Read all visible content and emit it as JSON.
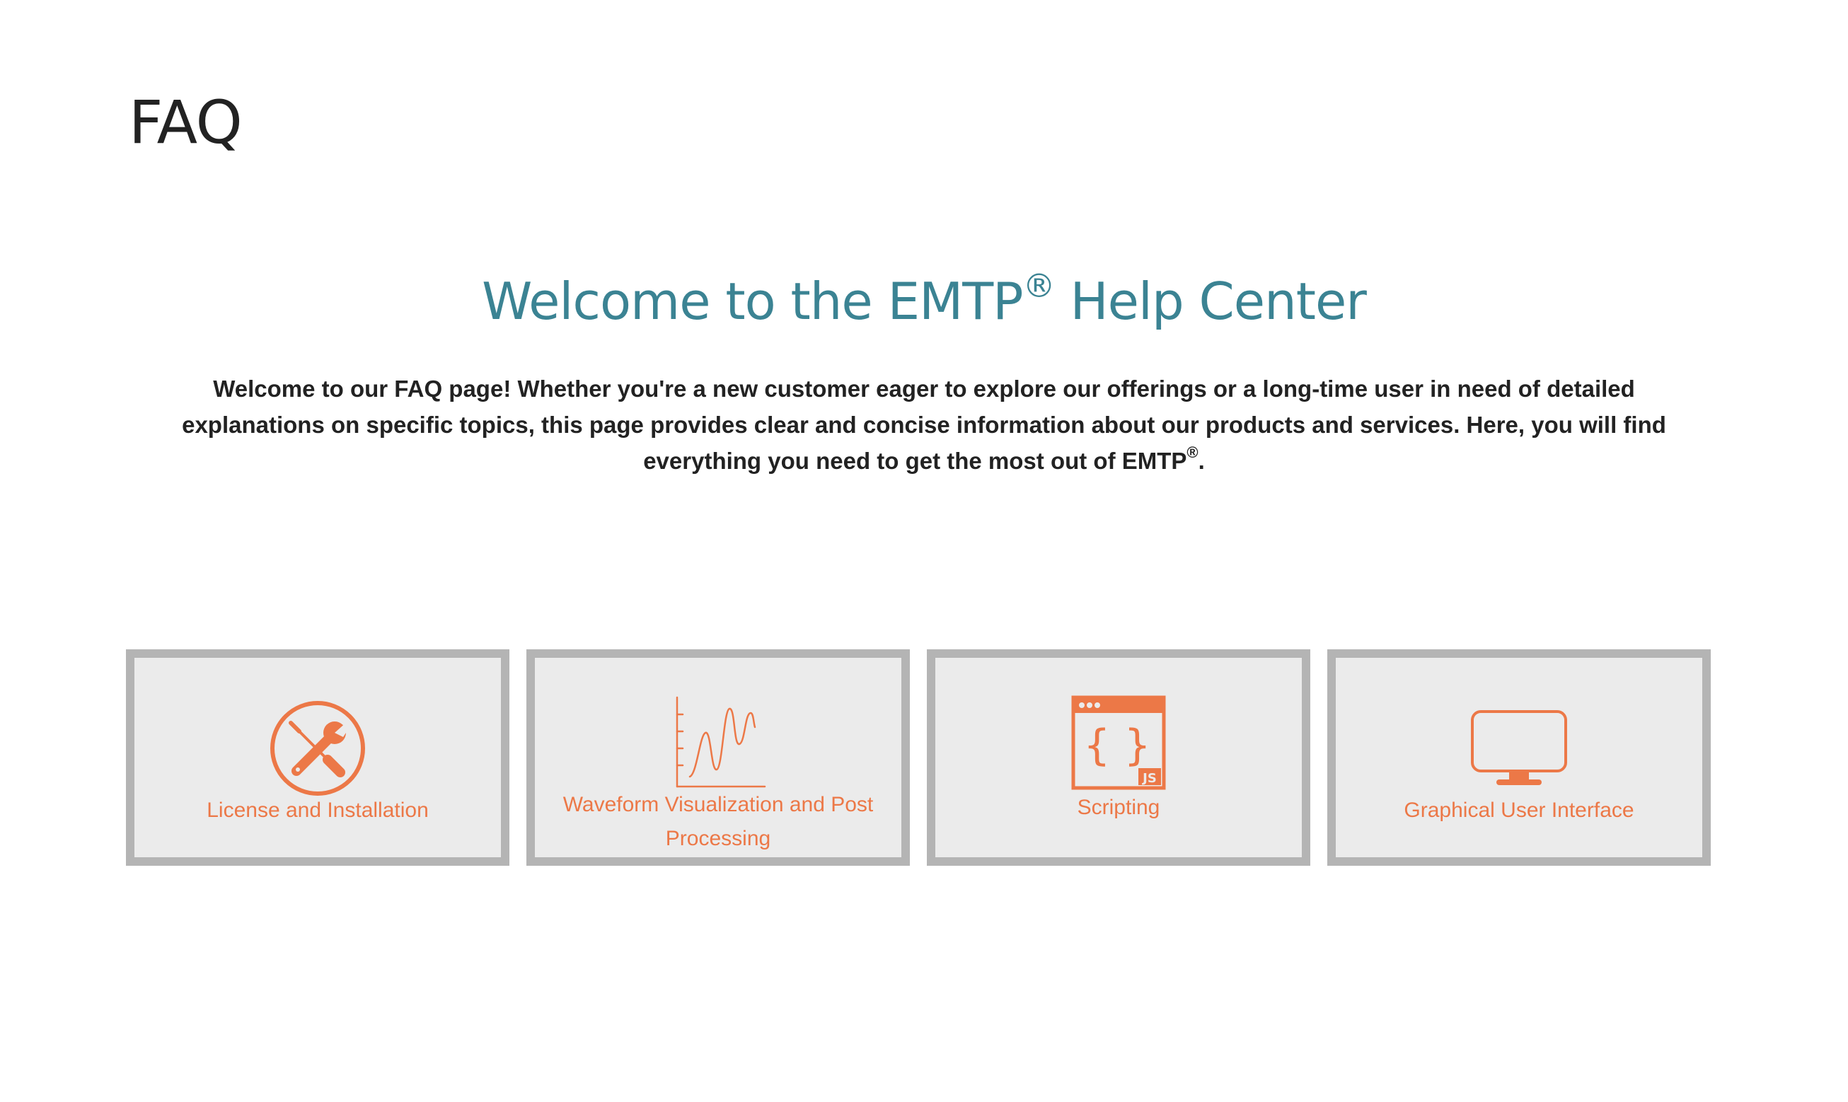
{
  "page": {
    "title": "FAQ"
  },
  "hero": {
    "heading": "Welcome to the EMTP",
    "heading_mark": "®",
    "heading_suffix": " Help Center",
    "intro": "Welcome to our FAQ page! Whether you're a new customer eager to explore our offerings or a long-time user in need of detailed explanations on specific topics, this page provides clear and concise information about our products and services. Here, you will find everything you need to get the most out of EMTP",
    "intro_mark": "®",
    "intro_suffix": "."
  },
  "categories": [
    {
      "label": "License and Installation",
      "icon": "tools-icon"
    },
    {
      "label": "Waveform Visualization and Post Processing",
      "icon": "waveform-chart-icon"
    },
    {
      "label": "Scripting",
      "icon": "javascript-code-icon"
    },
    {
      "label": "Graphical User Interface",
      "icon": "monitor-icon"
    }
  ],
  "colors": {
    "accent": "#ec7847",
    "heading": "#3b8393",
    "card_background": "#ebebeb",
    "card_border": "#b4b4b4",
    "text": "#222222"
  }
}
